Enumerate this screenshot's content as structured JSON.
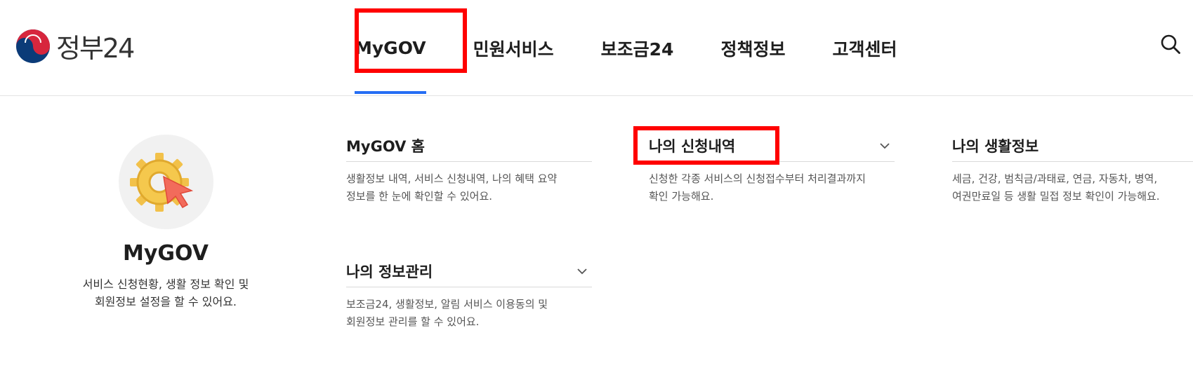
{
  "logo": {
    "text": "정부24"
  },
  "nav": [
    {
      "label": "MyGOV",
      "active": true
    },
    {
      "label": "민원서비스"
    },
    {
      "label": "보조금24"
    },
    {
      "label": "정책정보"
    },
    {
      "label": "고객센터"
    }
  ],
  "search": {
    "icon": "search-icon"
  },
  "intro": {
    "title": "MyGOV",
    "desc_line1": "서비스 신청현황, 생활 정보 확인 및",
    "desc_line2": "회원정보 설정을 할 수 있어요."
  },
  "menu": {
    "home": {
      "title": "MyGOV 홈",
      "desc_line1": "생활정보 내역, 서비스 신청내역, 나의 혜택 요약",
      "desc_line2": "정보를 한 눈에 확인할 수 있어요."
    },
    "info": {
      "title": "나의 정보관리",
      "desc_line1": "보조금24, 생활정보, 알림 서비스 이용동의 및",
      "desc_line2": "회원정보 관리를 할 수 있어요."
    },
    "applications": {
      "title": "나의 신청내역",
      "desc_line1": "신청한 각종 서비스의 신청접수부터 처리결과까지",
      "desc_line2": "확인 가능해요."
    },
    "life": {
      "title": "나의 생활정보",
      "desc_line1": "세금, 건강, 범칙금/과태료, 연금, 자동차, 병역,",
      "desc_line2": "여권만료일 등 생활 밀접 정보 확인이 가능해요."
    }
  },
  "colors": {
    "accent": "#256ef4",
    "highlight": "#ff0000"
  }
}
